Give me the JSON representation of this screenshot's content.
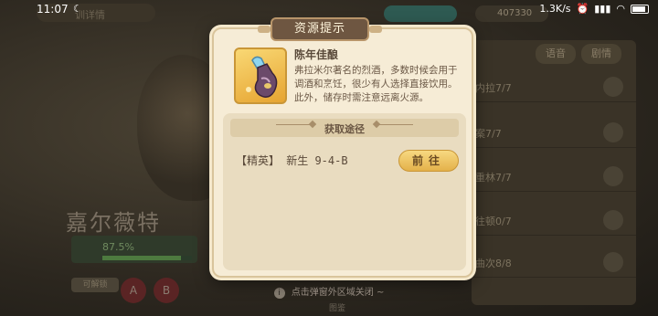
{
  "status_bar": {
    "time": "11:07",
    "network_speed": "1.3K/s",
    "icons": [
      "moon-icon",
      "alarm-icon",
      "signal-icon",
      "wifi-icon",
      "battery-icon"
    ]
  },
  "background": {
    "hero_name": "嘉尔薇特",
    "stat_percent": "87.5%",
    "stat_fraction": 0.875,
    "note_label": "可解锁",
    "button_a": "A",
    "button_b": "B",
    "top_left_label": "训详情",
    "resource_count": "407330",
    "tabs": [
      "语音",
      "剧情"
    ],
    "list_rows": [
      "内拉7/7",
      "案7/7",
      "重林7/7",
      "往顿0/7",
      "曲次8/8"
    ],
    "hint_icon": "i",
    "hint_text": "点击弹窗外区域关闭 ~",
    "bottom_label": "图鉴"
  },
  "dialog": {
    "title": "资源提示",
    "item": {
      "name": "陈年佳酿",
      "icon": "potion-bottle-icon",
      "description": "弗拉米尔著名的烈酒，多数时候会用于调酒和烹饪，很少有人选择直接饮用。此外，储存时需注意远离火源。"
    },
    "sources": {
      "title": "获取途径",
      "entries": [
        {
          "label": "【精英】 新生 9-4-B",
          "button": "前往"
        }
      ]
    }
  },
  "colors": {
    "dialog_bg": "#f6ecd6",
    "title_bg": "#6e5641",
    "button_gold": "#f0c865",
    "text_brown": "#5b4a3a"
  }
}
